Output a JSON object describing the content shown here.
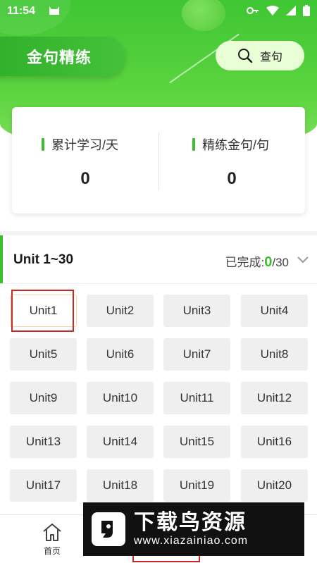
{
  "status_bar": {
    "time": "11:54"
  },
  "header": {
    "title": "金句精练",
    "search_label": "查句"
  },
  "stats": [
    {
      "label": "累计学习/天",
      "value": "0"
    },
    {
      "label": "精练金句/句",
      "value": "0"
    }
  ],
  "unit_section": {
    "range": "Unit 1~30",
    "progress_prefix": "已完成:",
    "completed": "0",
    "total_suffix": "/30",
    "selected_unit": "Unit1"
  },
  "units": [
    "Unit1",
    "Unit2",
    "Unit3",
    "Unit4",
    "Unit5",
    "Unit6",
    "Unit7",
    "Unit8",
    "Unit9",
    "Unit10",
    "Unit11",
    "Unit12",
    "Unit13",
    "Unit14",
    "Unit15",
    "Unit16",
    "Unit17",
    "Unit18",
    "Unit19",
    "Unit20"
  ],
  "bottom_nav": {
    "home_label": "首页"
  },
  "watermark": {
    "title": "下载鸟资源",
    "url": "www.xiazainiao.com"
  },
  "colors": {
    "accent": "#3cbf2c",
    "hero": "#4ccf36"
  }
}
